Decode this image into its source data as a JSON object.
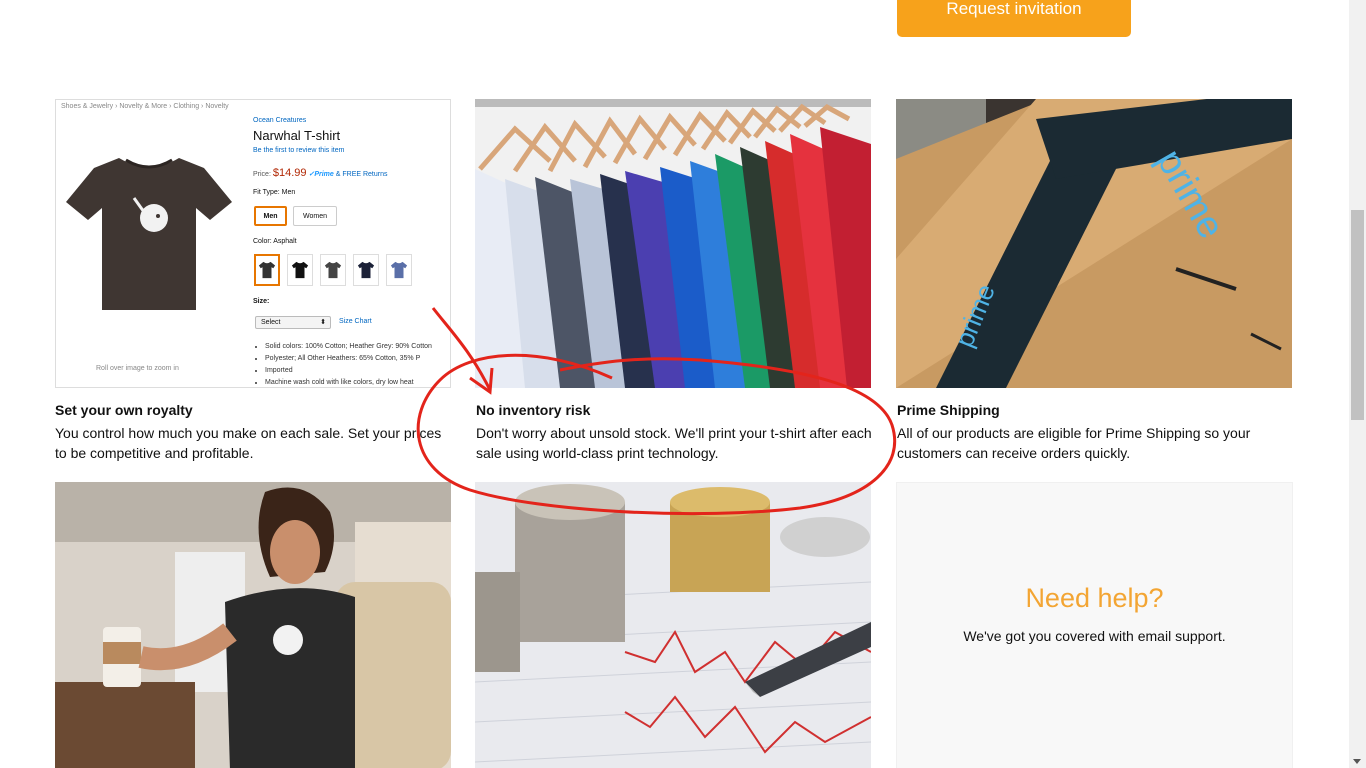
{
  "header": {
    "request_button": "Request invitation"
  },
  "product_page": {
    "breadcrumb": "Shoes & Jewelry › Novelty & More › Clothing › Novelty",
    "brand": "Ocean Creatures",
    "title": "Narwhal T-shirt",
    "review_link": "Be the first to review this item",
    "price_label": "Price:",
    "price": "$14.99",
    "prime": "✓Prime",
    "returns": "& FREE Returns",
    "fit_label": "Fit Type: Men",
    "fit_options": [
      "Men",
      "Women"
    ],
    "color_label": "Color: Asphalt",
    "size_label": "Size:",
    "size_select": "Select",
    "size_chart": "Size Chart",
    "bullets": [
      "Solid colors: 100% Cotton; Heather Grey: 90% Cotton",
      "Polyester; All Other Heathers: 65% Cotton, 35% P",
      "Imported",
      "Machine wash cold with like colors, dry low heat"
    ],
    "zoom_note": "Roll over image to zoom in"
  },
  "features": [
    {
      "title": "Set your own royalty",
      "text": "You control how much you make on each sale. Set your prices to be competitive and profitable."
    },
    {
      "title": "No inventory risk",
      "text": "Don't worry about unsold stock. We'll print your t-shirt after each sale using world-class print technology."
    },
    {
      "title": "Prime Shipping",
      "text": "All of our products are eligible for Prime Shipping so your customers can receive orders quickly."
    }
  ],
  "help": {
    "title": "Need help?",
    "text": "We've got you covered with email support."
  },
  "box_labels": {
    "prime": "prime"
  },
  "colors": {
    "accent": "#f7a21b",
    "help_title": "#f3a533",
    "annotation": "#e3241b"
  }
}
